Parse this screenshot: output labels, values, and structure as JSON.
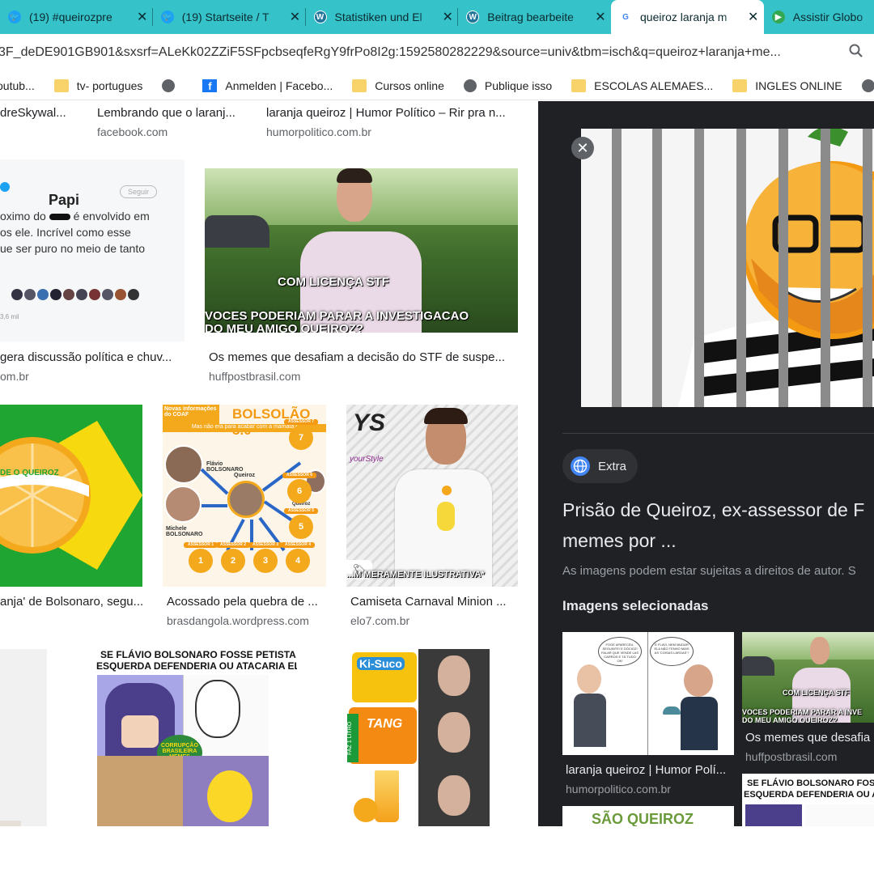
{
  "tabs": [
    {
      "label": "(19) #queirozpre",
      "icon": "twitter-icon",
      "color": "#1da1f2"
    },
    {
      "label": "(19) Startseite / T",
      "icon": "twitter-icon",
      "color": "#1da1f2"
    },
    {
      "label": "Statistiken und El",
      "icon": "wordpress-icon",
      "color": "#21759b"
    },
    {
      "label": "Beitrag bearbeite",
      "icon": "wordpress-icon",
      "color": "#21759b"
    },
    {
      "label": "queiroz laranja m",
      "icon": "google-icon",
      "color": "#4285f4",
      "active": true
    },
    {
      "label": "Assistir Globo",
      "icon": "globoplay-icon",
      "color": "#33a852"
    }
  ],
  "address": {
    "url": "3F_deDE901GB901&sxsrf=ALeKk02ZZiF5SFpcbseqfeRgY9frPo8I2g:1592580282229&source=univ&tbm=isch&q=queiroz+laranja+me..."
  },
  "bookmarks": [
    {
      "label": "outub...",
      "icon": "youtube-icon"
    },
    {
      "label": "tv- portugues",
      "icon": "folder-icon"
    },
    {
      "label": "",
      "icon": "globe-icon"
    },
    {
      "label": "Anmelden | Facebo...",
      "icon": "facebook-icon"
    },
    {
      "label": "Cursos online",
      "icon": "folder-icon"
    },
    {
      "label": "Publique isso",
      "icon": "globe-icon"
    },
    {
      "label": "ESCOLAS ALEMAES...",
      "icon": "folder-icon"
    },
    {
      "label": "INGLES ONLINE",
      "icon": "folder-icon"
    }
  ],
  "results": {
    "row0": [
      {
        "title": "dreSkywal...",
        "source": ""
      },
      {
        "title": "Lembrando que o laranj...",
        "source": "facebook.com"
      },
      {
        "title": "laranja queiroz | Humor Político – Rir pra n...",
        "source": "humorpolitico.com.br"
      }
    ],
    "row1": [
      {
        "title": "gera discussão política e chuv...",
        "source": "om.br"
      },
      {
        "title": "Os memes que desafiam a decisão do STF de suspe...",
        "source": "huffpostbrasil.com"
      }
    ],
    "row2": [
      {
        "title": "anja' de Bolsonaro, segu...",
        "source": ""
      },
      {
        "title": "Acossado pela quebra de ...",
        "source": "brasdangola.wordpress.com"
      },
      {
        "title": "Camiseta Carnaval Minion ...",
        "source": "elo7.com.br"
      }
    ]
  },
  "tweet": {
    "name": "Papi",
    "follow": "Seguir",
    "line1": "oximo do",
    "line1b": "é envolvido em",
    "line2": "os ele. Incrível como esse",
    "line3": "ue ser puro no meio de tanto",
    "stat": "3,6 mil"
  },
  "meme_stf": {
    "top": "COM LICENÇA STF",
    "bottom1": "VOCES PODERIAM PARAR A INVESTIGACAO",
    "bottom2": "DO MEU AMIGO QUEIROZ?"
  },
  "flag_text": "DE O QUEIROZ",
  "bolsolao": {
    "header": "Novas informações do COAF",
    "title": "BOLSOLÃO 3.0",
    "sub": "Mas não era para acabar com a mamata?",
    "flavio": "Flávio BOLSONARO",
    "michele": "Michele BOLSONARO",
    "queiroz": "Queiroz",
    "camila": "Camila Queiroz",
    "assessores": [
      "ASSESSOR 1",
      "ASSESSOR 2",
      "ASSESSOR 3",
      "ASSESSOR 4",
      "ASSESSOR 5",
      "ASSESSOR 6",
      "ASSESSOR 7"
    ],
    "nums": [
      "1",
      "2",
      "3",
      "4",
      "5",
      "6",
      "7"
    ]
  },
  "shirt": {
    "brand": "YS",
    "brand_sub": "yourStyle",
    "caption": "...M MERAMENTE ILUSTRATIVA*"
  },
  "batman_meme": {
    "line1": "SE FLÁVIO BOLSONARO FOSSE PETISTA A",
    "line2": "ESQUERDA DEFENDERIA OU ATACARIA ELE ?",
    "badge": "CORRUPÇÃO BRASILEIRA MEMES"
  },
  "kisuco": {
    "brand1": "Ki-Suco",
    "brand2": "TANG",
    "faz": "FAZ 1 LITRO"
  },
  "panel": {
    "source_label": "Extra",
    "title_line1": "Prisão de Queiroz, ex-assessor de F",
    "title_line2": "memes por ...",
    "rights": "As imagens podem estar sujeitas a direitos de autor. S",
    "selected_heading": "Imagens selecionadas",
    "related": [
      {
        "title": "laranja queiroz | Humor Polí...",
        "source": "humorpolitico.com.br"
      },
      {
        "title": "Os memes que desafia",
        "source": "huffpostbrasil.com"
      }
    ],
    "thumb_meme_top": "COM LICENÇA STF",
    "thumb_meme_bottom": "VOCES PODERIAM PARAR A INVE",
    "thumb_meme_bottom2": "DO MEU AMIGO QUEIROZ?",
    "thumb_batman1": "SE FLÁVIO BOLSONARO FOSSE PE",
    "thumb_batman2": "ESQUERDA DEFENDERIA OU ATACA",
    "thumb_sao": "SÃO QUEIROZ",
    "cartoon_bubble1": "FOGE APARECEU, SEGUINTE! E DÓCIOZ! FALAR QUE VENDE LAS CARROS E TÁ TUDO OK!",
    "cartoon_bubble2": "E FLAVI, NEM MUDAR ELA NÃO TENHO MAIS AS 'COISAS LARGAS'?"
  },
  "colors": {
    "tabbar": "#35c2c9",
    "panel": "#202124",
    "brazil_green": "#1fa531",
    "brazil_yellow": "#f6d90e",
    "orange": "#f4a81c"
  }
}
